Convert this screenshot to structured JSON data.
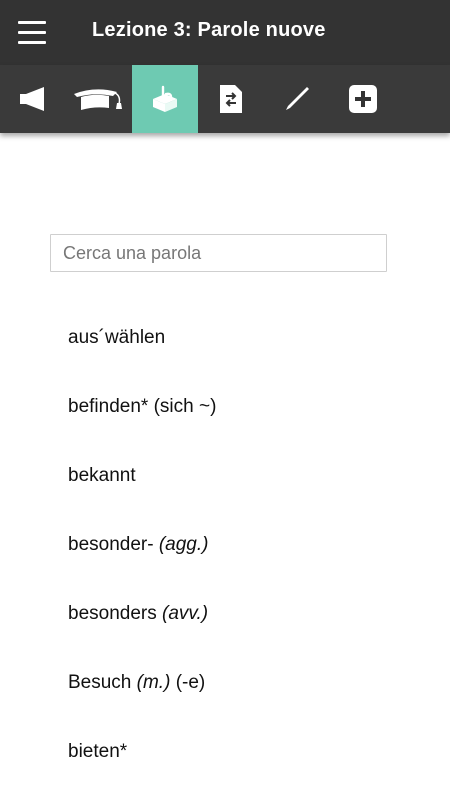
{
  "header": {
    "title": "Lezione 3: Parole nuove"
  },
  "toolbar": {
    "accent": "#6ecab2",
    "background": "#3a3a3a",
    "items": [
      {
        "icon": "megaphone-icon",
        "active": false
      },
      {
        "icon": "graduation-cap-icon",
        "active": false
      },
      {
        "icon": "vocabulary-box-icon",
        "active": true
      },
      {
        "icon": "document-swap-icon",
        "active": false
      },
      {
        "icon": "pen-icon",
        "active": false
      },
      {
        "icon": "plus-box-icon",
        "active": false
      }
    ]
  },
  "search": {
    "placeholder": "Cerca una parola",
    "value": ""
  },
  "words": [
    {
      "main": "aus´wählen",
      "grammar": "",
      "suffix": ""
    },
    {
      "main": "befinden* (sich ~)",
      "grammar": "",
      "suffix": ""
    },
    {
      "main": "bekannt",
      "grammar": "",
      "suffix": ""
    },
    {
      "main": "besonder- ",
      "grammar": "(agg.)",
      "suffix": ""
    },
    {
      "main": "besonders ",
      "grammar": "(avv.)",
      "suffix": ""
    },
    {
      "main": "Besuch ",
      "grammar": "(m.)",
      "suffix": " (-e)"
    },
    {
      "main": "bieten*",
      "grammar": "",
      "suffix": ""
    }
  ]
}
